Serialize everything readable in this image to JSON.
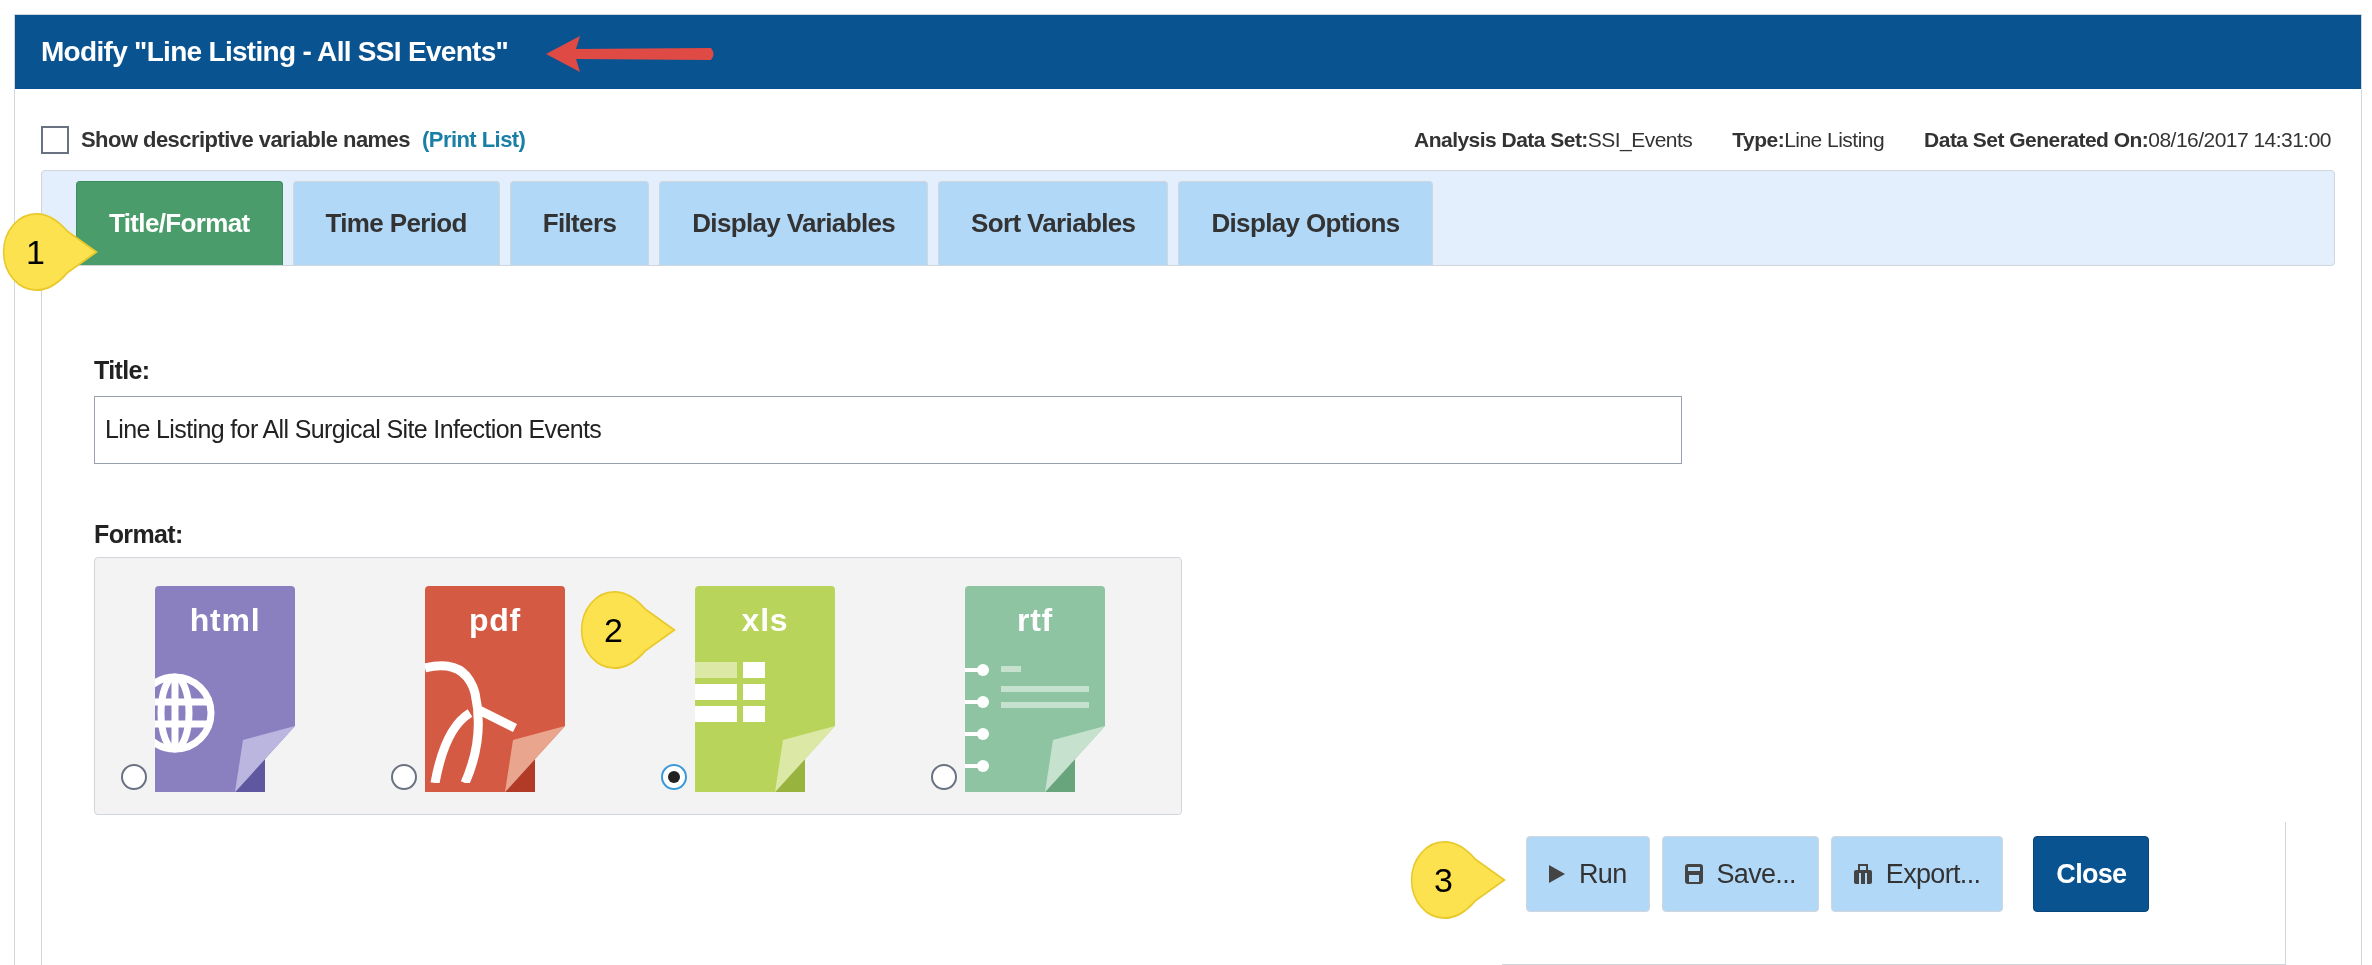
{
  "window": {
    "title": "Modify \"Line Listing - All SSI Events\""
  },
  "options": {
    "show_descriptive": {
      "label": "Show descriptive variable names",
      "checked": false
    },
    "print_list": "(Print List)"
  },
  "info": [
    {
      "label": "Analysis Data Set:",
      "value": "SSI_Events"
    },
    {
      "label": "Type:",
      "value": "Line Listing"
    },
    {
      "label": "Data Set Generated On:",
      "value": "08/16/2017 14:31:00"
    }
  ],
  "tabs": [
    {
      "label": "Title/Format",
      "selected": true
    },
    {
      "label": "Time Period",
      "selected": false
    },
    {
      "label": "Filters",
      "selected": false
    },
    {
      "label": "Display Variables",
      "selected": false
    },
    {
      "label": "Sort Variables",
      "selected": false
    },
    {
      "label": "Display Options",
      "selected": false
    }
  ],
  "title_field": {
    "label": "Title:",
    "value": "Line Listing for All Surgical Site Infection Events"
  },
  "format": {
    "label": "Format:",
    "options": [
      {
        "label": "html",
        "kind": "html",
        "selected": false
      },
      {
        "label": "pdf",
        "kind": "pdf",
        "selected": false
      },
      {
        "label": "xls",
        "kind": "xls",
        "selected": true
      },
      {
        "label": "rtf",
        "kind": "rtf",
        "selected": false
      }
    ]
  },
  "buttons": [
    {
      "label": "Run",
      "kind": "run"
    },
    {
      "label": "Save...",
      "kind": "save"
    },
    {
      "label": "Export...",
      "kind": "export"
    },
    {
      "label": "Close",
      "kind": "close"
    }
  ],
  "callouts": [
    "1",
    "2",
    "3"
  ]
}
